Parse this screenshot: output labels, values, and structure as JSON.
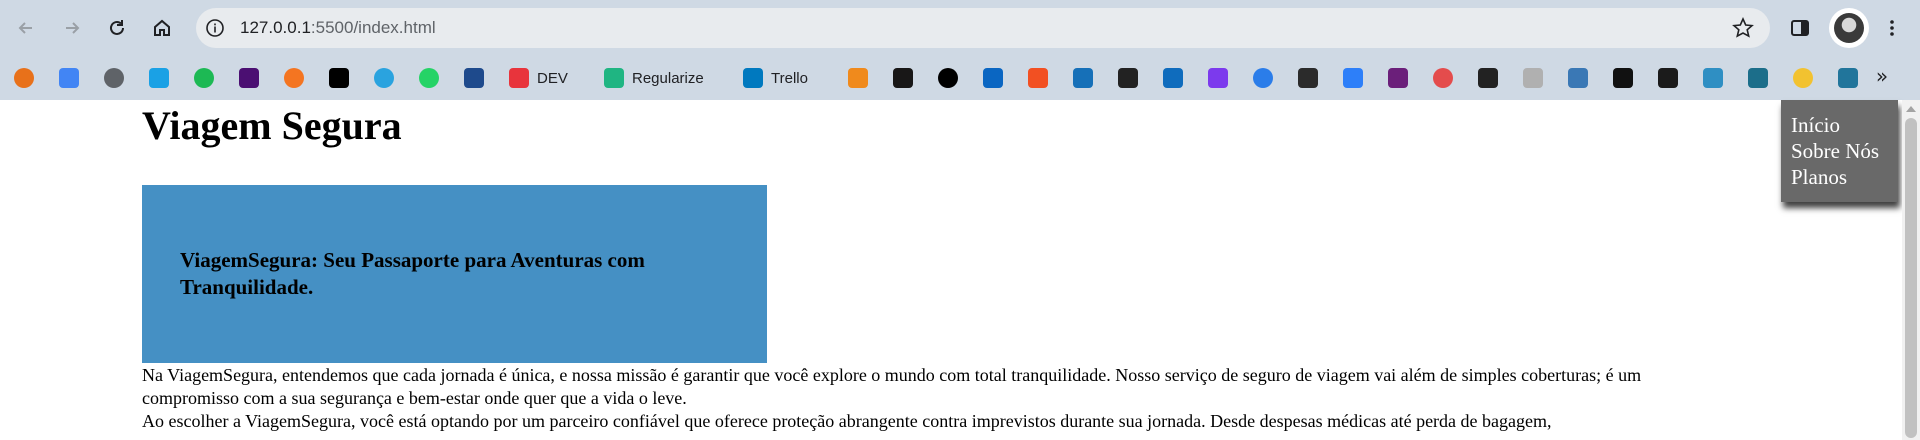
{
  "browser": {
    "url_host": "127.0.0.1",
    "url_path": ":5500/index.html",
    "back_icon": "arrow-left-icon",
    "forward_icon": "arrow-right-icon",
    "reload_icon": "reload-icon",
    "home_icon": "home-icon",
    "info_icon": "info-icon",
    "star_icon": "star-icon",
    "sidepanel_icon": "side-panel-icon",
    "menu_icon": "kebab-menu-icon",
    "more_glyph": "»"
  },
  "bookmarks": [
    {
      "label": "",
      "icon": "colorful-ring-icon",
      "color": "#e8711a"
    },
    {
      "label": "",
      "icon": "google-translate-icon",
      "color": "#4285f4"
    },
    {
      "label": "",
      "icon": "globe-icon",
      "color": "#5f6368"
    },
    {
      "label": "",
      "icon": "cloud-icon",
      "color": "#1aa1e5"
    },
    {
      "label": "",
      "icon": "spotify-icon",
      "color": "#1db954"
    },
    {
      "label": "",
      "icon": "m-icon",
      "color": "#4b0f72"
    },
    {
      "label": "",
      "icon": "crunchyroll-icon",
      "color": "#f47521"
    },
    {
      "label": "",
      "icon": "x-icon",
      "color": "#000000"
    },
    {
      "label": "",
      "icon": "telegram-icon",
      "color": "#2aa3df"
    },
    {
      "label": "",
      "icon": "whatsapp-icon",
      "color": "#25d366"
    },
    {
      "label": "",
      "icon": "s-icon",
      "color": "#1e4a8c"
    },
    {
      "label": "DEV",
      "icon": "dev-icon",
      "color": "#e8343c"
    },
    {
      "label": "Regularize",
      "icon": "regularize-icon",
      "color": "#1fb582"
    },
    {
      "label": "Trello",
      "icon": "trello-icon",
      "color": "#0079bf"
    },
    {
      "label": "",
      "icon": "orange-grid-icon",
      "color": "#f08a1c"
    },
    {
      "label": "",
      "icon": "github-icon",
      "color": "#181717"
    },
    {
      "label": "",
      "icon": "triangle-icon",
      "color": "#000000"
    },
    {
      "label": "",
      "icon": "linkedin-icon",
      "color": "#0a66c2"
    },
    {
      "label": "",
      "icon": "microsoft-icon",
      "color": "#f25022"
    },
    {
      "label": "",
      "icon": "lv-icon",
      "color": "#1670b8"
    },
    {
      "label": "",
      "icon": "knot-icon",
      "color": "#222222"
    },
    {
      "label": "",
      "icon": "outlook-icon",
      "color": "#0f6cbd"
    },
    {
      "label": "",
      "icon": "purple-shield-icon",
      "color": "#7c3aed"
    },
    {
      "label": "",
      "icon": "blue-ring-icon",
      "color": "#2b7de9"
    },
    {
      "label": "",
      "icon": "nin-icon",
      "color": "#2b2b2b"
    },
    {
      "label": "",
      "icon": "blue-drop-icon",
      "color": "#2d7ff9"
    },
    {
      "label": "",
      "icon": "goggles-icon",
      "color": "#6b1f7a"
    },
    {
      "label": "",
      "icon": "check-circle-icon",
      "color": "#e44c4c"
    },
    {
      "label": "",
      "icon": "openai-icon",
      "color": "#222222"
    },
    {
      "label": "",
      "icon": "gray-logo-icon",
      "color": "#b0b0b0"
    },
    {
      "label": "",
      "icon": "lj-icon",
      "color": "#3a78b5"
    },
    {
      "label": "",
      "icon": "g-square-icon",
      "color": "#111111"
    },
    {
      "label": "",
      "icon": "r-icon",
      "color": "#1b1b1b"
    },
    {
      "label": "",
      "icon": "react-icon",
      "color": "#2f8fc3"
    },
    {
      "label": "",
      "icon": "react-dark-icon",
      "color": "#1c6e8a"
    },
    {
      "label": "",
      "icon": "n-circle-icon",
      "color": "#f2c230"
    },
    {
      "label": "",
      "icon": "wordpress-icon",
      "color": "#21759b"
    }
  ],
  "page": {
    "title": "Viagem Segura",
    "hero_text": "ViagemSegura: Seu Passaporte para Aventuras com Tranquilidade.",
    "paragraph_1": "Na ViagemSegura, entendemos que cada jornada é única, e nossa missão é garantir que você explore o mundo com total tranquilidade. Nosso serviço de seguro de viagem vai além de simples coberturas; é um compromisso com a sua segurança e bem-estar onde quer que a vida o leve.",
    "paragraph_2": "Ao escolher a ViagemSegura, você está optando por um parceiro confiável que oferece proteção abrangente contra imprevistos durante sua jornada. Desde despesas médicas até perda de bagagem,",
    "nav": [
      "Início",
      "Sobre Nós",
      "Planos"
    ],
    "hero_color": "#4590c4",
    "menu_color": "#696969"
  }
}
